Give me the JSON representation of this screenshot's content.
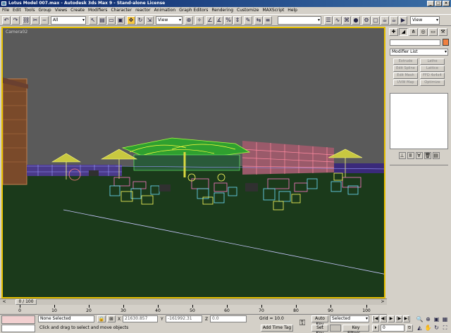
{
  "window": {
    "title": "Lotus Model 007.max - Autodesk 3ds Max 9 - Stand-alone License",
    "minimize": "_",
    "maximize": "□",
    "close": "×"
  },
  "menu": [
    "File",
    "Edit",
    "Tools",
    "Group",
    "Views",
    "Create",
    "Modifiers",
    "Character",
    "reactor",
    "Animation",
    "Graph Editors",
    "Rendering",
    "Customize",
    "MAXScript",
    "Help"
  ],
  "toolbar": {
    "selection_filter": "All",
    "ref_coord": "View",
    "named_selection": "",
    "view_dropdown": "View"
  },
  "viewport": {
    "label": "Camera02"
  },
  "command_panel": {
    "modifier_list": "Modifier List",
    "buttons": [
      "Extrude",
      "Lathe",
      "Edit Spline",
      "Lattice",
      "Edit Mesh",
      "FFD 4x4x4",
      "UVW Map",
      "Optimize"
    ]
  },
  "time_slider": {
    "position": "0 / 100",
    "prev": "<",
    "next": ">"
  },
  "track_ticks": [
    "0",
    "10",
    "20",
    "30",
    "40",
    "50",
    "60",
    "70",
    "80",
    "90",
    "100"
  ],
  "status": {
    "selection": "None Selected",
    "prompt": "Click and drag to select and move objects",
    "x_label": "X",
    "x_value": "21630.857",
    "y_label": "Y",
    "y_value": "-161992.31",
    "z_label": "Z",
    "z_value": "0.0",
    "grid": "Grid = 10.0",
    "add_time_tag": "Add Time Tag",
    "auto_key": "Auto Key",
    "set_key": "Set Key",
    "key_mode": "Selected",
    "key_filters": "Key Filters...",
    "frame": "0"
  },
  "icons": {
    "key": "key-icon"
  },
  "colors": {
    "viewport_sky": "#5a5a5a",
    "viewport_ground": "#1b3a1b",
    "active_border": "#e7c000"
  }
}
